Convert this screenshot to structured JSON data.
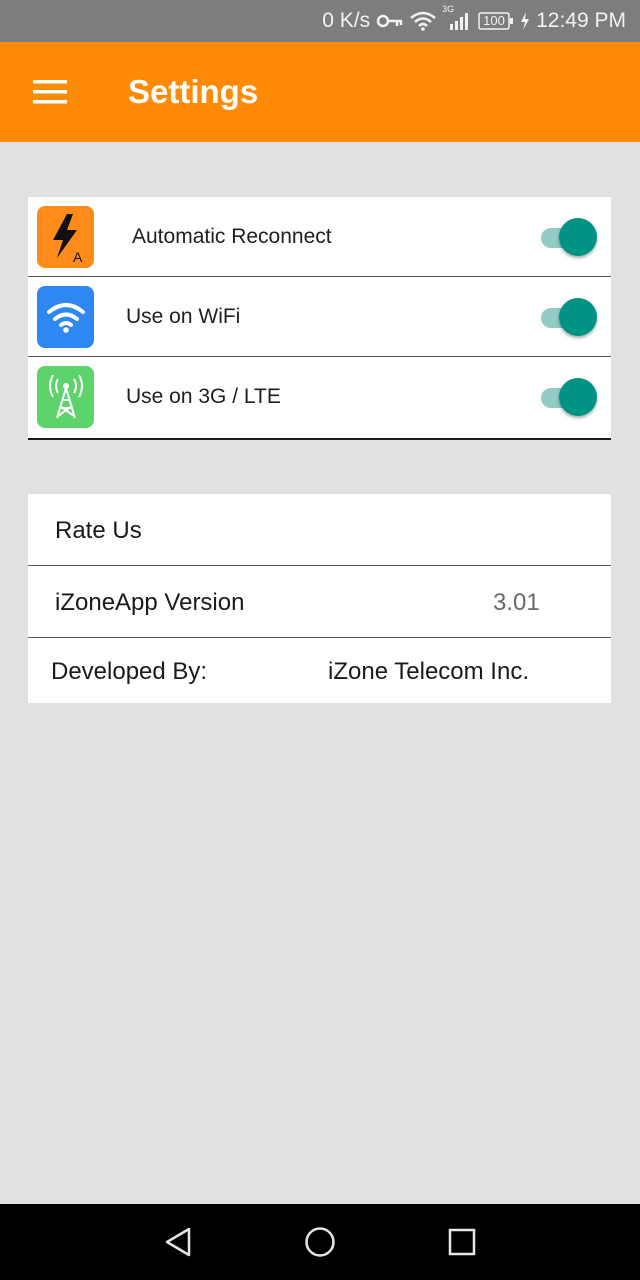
{
  "status_bar": {
    "speed": "0 K/s",
    "network_type": "3G",
    "battery": "100",
    "time": "12:49 PM",
    "icons": [
      "key-icon",
      "wifi-icon",
      "signal-icon",
      "battery-icon",
      "charging-icon"
    ]
  },
  "app_bar": {
    "title": "Settings",
    "menu_icon": "hamburger-menu-icon",
    "color": "#ff8a05"
  },
  "toggles": [
    {
      "label": "Automatic Reconnect",
      "icon": "lightning-a-icon",
      "icon_color": "#ff8c1a",
      "icon_letter": "A",
      "enabled": true
    },
    {
      "label": "Use on WiFi",
      "icon": "wifi-app-icon",
      "icon_color": "#2f87f4",
      "enabled": true
    },
    {
      "label": "Use on 3G / LTE",
      "icon": "cell-tower-icon",
      "icon_color": "#5cd36b",
      "enabled": true
    }
  ],
  "info": {
    "rate_label": "Rate Us",
    "version_label": "iZoneApp Version",
    "version_value": "3.01",
    "developer_label": "Developed By:",
    "developer_value": "iZone Telecom Inc."
  },
  "nav": {
    "icons": [
      "back-icon",
      "home-icon",
      "recents-icon"
    ]
  },
  "colors": {
    "toggle_on": "#009282",
    "toggle_track": "#92cbc4",
    "background": "#e1e1e1"
  }
}
